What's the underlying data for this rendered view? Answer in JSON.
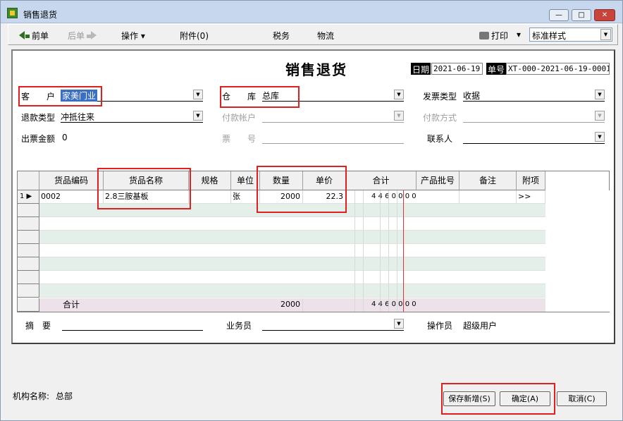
{
  "window": {
    "title": "销售退货",
    "min": "—",
    "max": "□",
    "close": "✕"
  },
  "toolbar": {
    "prev": "前单",
    "next": "后单",
    "ops": "操作 ▾",
    "attach": "附件(0)",
    "tax": "税务",
    "logistics": "物流",
    "print": "打印",
    "print_arrow": "▾",
    "style_value": "标准样式"
  },
  "doc": {
    "title": "销售退货",
    "date_label": "日期",
    "date_value": "2021-06-19",
    "no_label": "单号",
    "no_value": "XT-000-2021-06-19-0001"
  },
  "form": {
    "customer_label": "客　　户",
    "customer_value": "家美门业",
    "warehouse_label": "仓　　库",
    "warehouse_value": "总库",
    "invoice_type_label": "发票类型",
    "invoice_type_value": "收据",
    "refund_type_label": "退款类型",
    "refund_type_value": "冲抵往来",
    "pay_account_label": "付款帐户",
    "pay_method_label": "付款方式",
    "invoice_amount_label": "出票金额",
    "invoice_amount_value": "0",
    "ticket_no_label": "票　　号",
    "contact_label": "联系人",
    "memo_label": "摘　要",
    "salesman_label": "业务员",
    "operator_label": "操作员",
    "operator_value": "超级用户"
  },
  "grid": {
    "headers": {
      "code": "货品编码",
      "name": "货品名称",
      "spec": "规格",
      "unit": "单位",
      "qty": "数量",
      "price": "单价",
      "total": "合计",
      "batch": "产品批号",
      "note": "备注",
      "extra": "附项"
    },
    "row1": {
      "index": "1",
      "code": "0002",
      "name": "2.8三胺基板",
      "unit": "张",
      "qty": "2000",
      "price": "22.3",
      "total_digits": "4 4 6 0 0 0 0",
      "extra": ">>"
    },
    "sum": {
      "label": "合计",
      "qty": "2000",
      "total_digits": "4 4 6 0 0 0 0"
    }
  },
  "footer": {
    "org_label": "机构名称:",
    "org_value": "总部"
  },
  "buttons": {
    "save_new": "保存新增(S)",
    "confirm": "确定(A)",
    "cancel": "取消(C)"
  }
}
